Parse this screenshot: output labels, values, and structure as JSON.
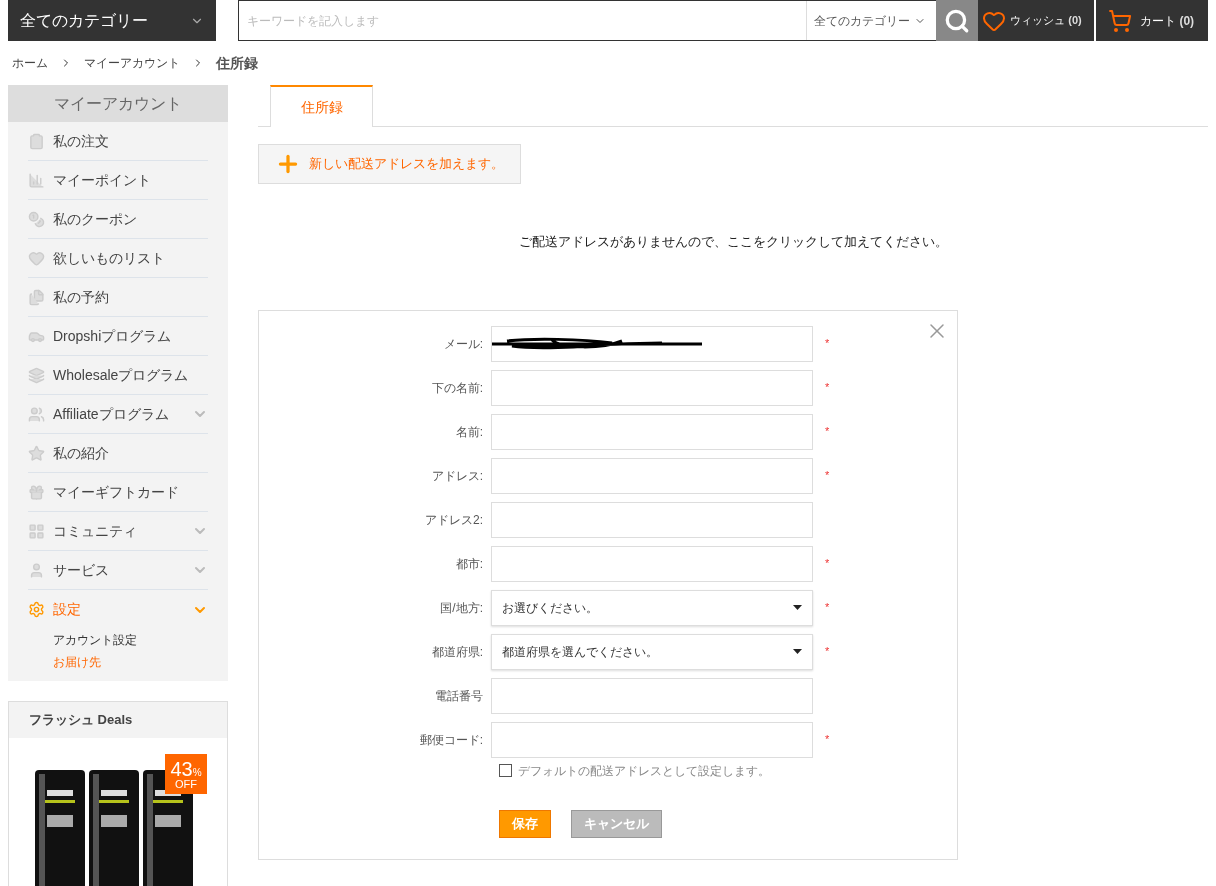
{
  "header": {
    "category_menu": "全てのカテゴリー",
    "search": {
      "placeholder": "キーワードを記入します",
      "category": "全てのカテゴリー"
    },
    "wish": {
      "label": "ウィッシュ",
      "count": "(0)"
    },
    "cart": {
      "label": "カート",
      "count": "(0)"
    }
  },
  "breadcrumb": [
    {
      "label": "ホーム",
      "current": false
    },
    {
      "label": "マイーアカウント",
      "current": false
    },
    {
      "label": "住所録",
      "current": true
    }
  ],
  "sidebar": {
    "title": "マイーアカウント",
    "items": [
      {
        "label": "私の注文",
        "expandable": false,
        "selected": false
      },
      {
        "label": "マイーポイント",
        "expandable": false,
        "selected": false
      },
      {
        "label": "私のクーポン",
        "expandable": false,
        "selected": false
      },
      {
        "label": "欲しいものリスト",
        "expandable": false,
        "selected": false
      },
      {
        "label": "私の予約",
        "expandable": false,
        "selected": false
      },
      {
        "label": "Dropshiプログラム",
        "expandable": false,
        "selected": false
      },
      {
        "label": "Wholesaleプログラム",
        "expandable": false,
        "selected": false
      },
      {
        "label": "Affiliateプログラム",
        "expandable": true,
        "selected": false
      },
      {
        "label": "私の紹介",
        "expandable": false,
        "selected": false
      },
      {
        "label": "マイーギフトカード",
        "expandable": false,
        "selected": false
      },
      {
        "label": "コミュニティ",
        "expandable": true,
        "selected": false
      },
      {
        "label": "サービス",
        "expandable": true,
        "selected": false
      },
      {
        "label": "設定",
        "expandable": true,
        "selected": true,
        "children": [
          {
            "label": "アカウント設定",
            "selected": false
          },
          {
            "label": "お届け先",
            "selected": true
          }
        ]
      }
    ]
  },
  "flash_deals": {
    "title": "フラッシュ Deals",
    "badge": {
      "number": "43",
      "percent": "%",
      "off": "OFF"
    }
  },
  "tabs": [
    {
      "label": "住所録",
      "selected": true
    }
  ],
  "add_button": "新しい配送アドレスを加えます。",
  "empty_message": "ご配送アドレスがありませんので、ここをクリックして加えてください。",
  "form": {
    "fields": [
      {
        "label": "メール:",
        "kind": "scribbled",
        "required": true
      },
      {
        "label": "下の名前:",
        "kind": "text",
        "required": true
      },
      {
        "label": "名前:",
        "kind": "text",
        "required": true
      },
      {
        "label": "アドレス:",
        "kind": "text",
        "required": true
      },
      {
        "label": "アドレス2:",
        "kind": "text",
        "required": false
      },
      {
        "label": "都市:",
        "kind": "text",
        "required": true
      },
      {
        "label": "国/地方:",
        "kind": "select",
        "value": "お選びください。",
        "required": true
      },
      {
        "label": "都道府県:",
        "kind": "select",
        "value": "都道府県を選んでください。",
        "required": true
      },
      {
        "label": "電話番号",
        "kind": "text",
        "required": false
      },
      {
        "label": "郵便コード:",
        "kind": "text",
        "required": true
      }
    ],
    "required_mark": "*",
    "default_checkbox": {
      "label": "デフォルトの配送アドレスとして設定します。",
      "checked": false
    },
    "buttons": [
      {
        "label": "保存",
        "kind": "primary"
      },
      {
        "label": "キャンセル",
        "kind": "secondary"
      }
    ]
  }
}
